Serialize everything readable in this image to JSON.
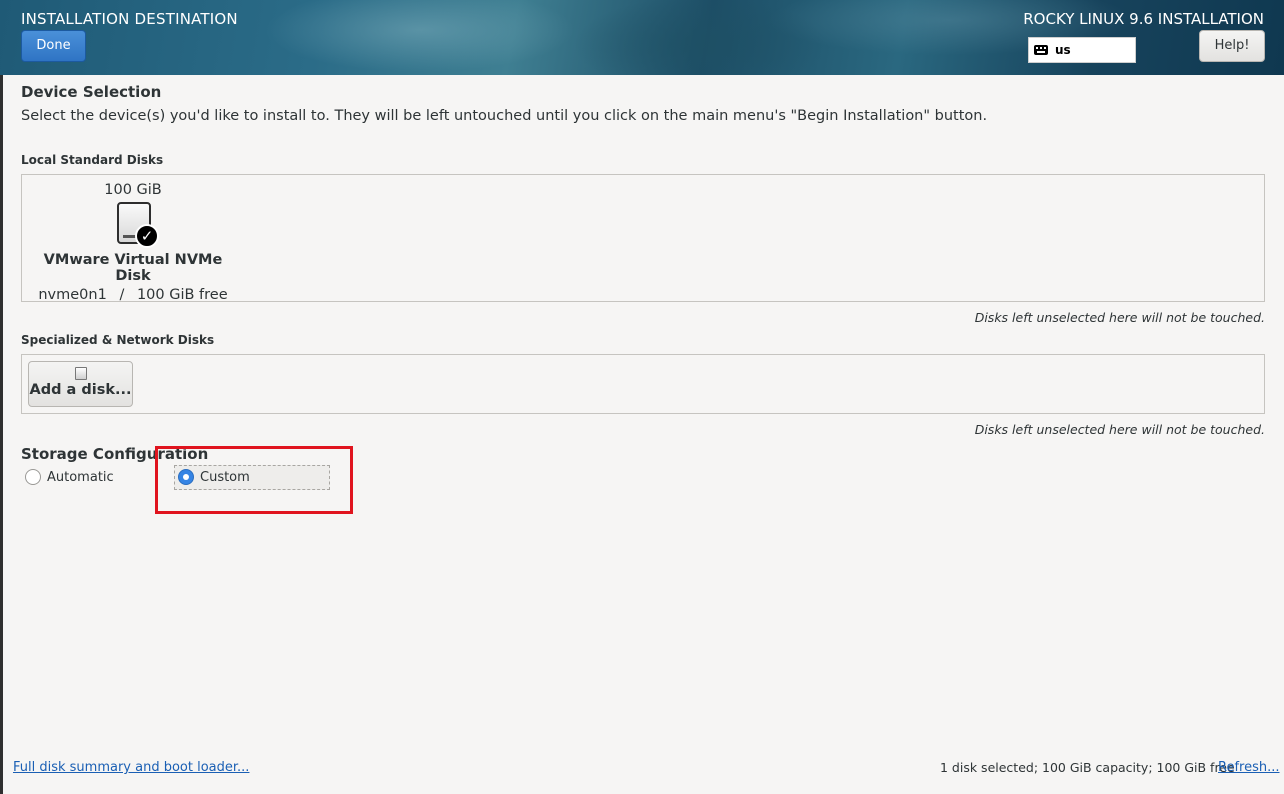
{
  "header": {
    "title": "INSTALLATION DESTINATION",
    "done_label": "Done",
    "product_title": "ROCKY LINUX 9.6 INSTALLATION",
    "keyboard_layout": "us",
    "help_label": "Help!"
  },
  "device_selection": {
    "title": "Device Selection",
    "instructions": "Select the device(s) you'd like to install to.  They will be left untouched until you click on the main menu's \"Begin Installation\" button."
  },
  "local_disks": {
    "label": "Local Standard Disks",
    "disks": [
      {
        "size": "100 GiB",
        "name": "VMware Virtual NVMe Disk",
        "device": "nvme0n1",
        "separator": "/",
        "free": "100 GiB free",
        "selected": true
      }
    ],
    "note": "Disks left unselected here will not be touched."
  },
  "network_disks": {
    "label": "Specialized & Network Disks",
    "add_label": "Add a disk...",
    "note": "Disks left unselected here will not be touched."
  },
  "storage_config": {
    "title": "Storage Configuration",
    "options": [
      {
        "label": "Automatic",
        "selected": false
      },
      {
        "label": "Custom",
        "selected": true
      }
    ]
  },
  "footer": {
    "summary_link": "Full disk summary and boot loader...",
    "summary_text": "1 disk selected; 100 GiB capacity; 100 GiB free",
    "refresh_link": "Refresh..."
  },
  "colors": {
    "accent": "#3584e4",
    "highlight": "#e0141e",
    "link": "#1a5fb4"
  }
}
